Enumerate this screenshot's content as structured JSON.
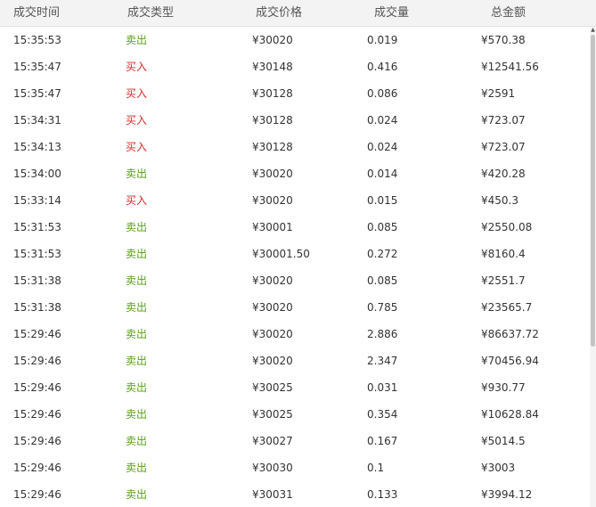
{
  "header": {
    "time": "成交时间",
    "type": "成交类型",
    "price": "成交价格",
    "qty": "成交量",
    "total": "总金额"
  },
  "colors": {
    "sell": "#5a9e1a",
    "buy": "#d62a2a",
    "header_bg": "#f3f3f3"
  },
  "icons": {
    "scroll_up": "scroll-up-arrow-icon"
  },
  "trades": [
    {
      "time": "15:35:53",
      "type": "卖出",
      "side": "sell",
      "price": "¥30020",
      "qty": "0.019",
      "total": "¥570.38"
    },
    {
      "time": "15:35:47",
      "type": "买入",
      "side": "buy",
      "price": "¥30148",
      "qty": "0.416",
      "total": "¥12541.56"
    },
    {
      "time": "15:35:47",
      "type": "买入",
      "side": "buy",
      "price": "¥30128",
      "qty": "0.086",
      "total": "¥2591"
    },
    {
      "time": "15:34:31",
      "type": "买入",
      "side": "buy",
      "price": "¥30128",
      "qty": "0.024",
      "total": "¥723.07"
    },
    {
      "time": "15:34:13",
      "type": "买入",
      "side": "buy",
      "price": "¥30128",
      "qty": "0.024",
      "total": "¥723.07"
    },
    {
      "time": "15:34:00",
      "type": "卖出",
      "side": "sell",
      "price": "¥30020",
      "qty": "0.014",
      "total": "¥420.28"
    },
    {
      "time": "15:33:14",
      "type": "买入",
      "side": "buy",
      "price": "¥30020",
      "qty": "0.015",
      "total": "¥450.3"
    },
    {
      "time": "15:31:53",
      "type": "卖出",
      "side": "sell",
      "price": "¥30001",
      "qty": "0.085",
      "total": "¥2550.08"
    },
    {
      "time": "15:31:53",
      "type": "卖出",
      "side": "sell",
      "price": "¥30001.50",
      "qty": "0.272",
      "total": "¥8160.4"
    },
    {
      "time": "15:31:38",
      "type": "卖出",
      "side": "sell",
      "price": "¥30020",
      "qty": "0.085",
      "total": "¥2551.7"
    },
    {
      "time": "15:31:38",
      "type": "卖出",
      "side": "sell",
      "price": "¥30020",
      "qty": "0.785",
      "total": "¥23565.7"
    },
    {
      "time": "15:29:46",
      "type": "卖出",
      "side": "sell",
      "price": "¥30020",
      "qty": "2.886",
      "total": "¥86637.72"
    },
    {
      "time": "15:29:46",
      "type": "卖出",
      "side": "sell",
      "price": "¥30020",
      "qty": "2.347",
      "total": "¥70456.94"
    },
    {
      "time": "15:29:46",
      "type": "卖出",
      "side": "sell",
      "price": "¥30025",
      "qty": "0.031",
      "total": "¥930.77"
    },
    {
      "time": "15:29:46",
      "type": "卖出",
      "side": "sell",
      "price": "¥30025",
      "qty": "0.354",
      "total": "¥10628.84"
    },
    {
      "time": "15:29:46",
      "type": "卖出",
      "side": "sell",
      "price": "¥30027",
      "qty": "0.167",
      "total": "¥5014.5"
    },
    {
      "time": "15:29:46",
      "type": "卖出",
      "side": "sell",
      "price": "¥30030",
      "qty": "0.1",
      "total": "¥3003"
    },
    {
      "time": "15:29:46",
      "type": "卖出",
      "side": "sell",
      "price": "¥30031",
      "qty": "0.133",
      "total": "¥3994.12"
    }
  ]
}
